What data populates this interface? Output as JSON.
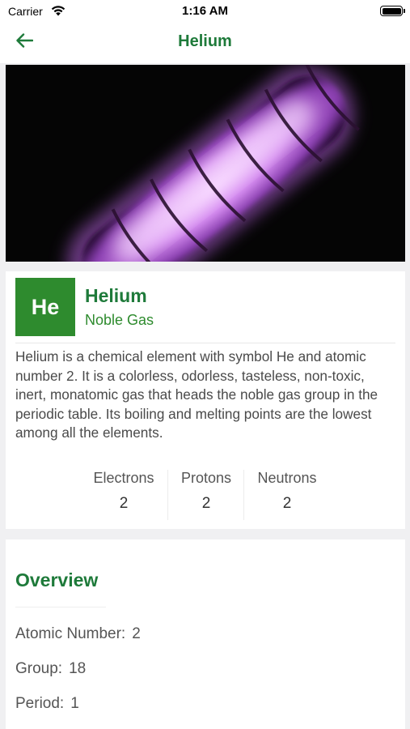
{
  "status_bar": {
    "carrier": "Carrier",
    "time": "1:16 AM"
  },
  "nav": {
    "title": "Helium",
    "back_icon": "arrow-left-icon"
  },
  "colors": {
    "accent": "#1e7a3a",
    "symbol_bg": "#2e8b2e",
    "page_bg": "#f0f0f2"
  },
  "element": {
    "symbol": "He",
    "name": "Helium",
    "category": "Noble Gas",
    "description": "Helium is a chemical element with symbol He and atomic number 2. It is a colorless, odorless, tasteless, non-toxic, inert, monatomic gas that heads the noble gas group in the periodic table. Its boiling and melting points are the lowest among all the elements.",
    "stats": [
      {
        "label": "Electrons",
        "value": "2"
      },
      {
        "label": "Protons",
        "value": "2"
      },
      {
        "label": "Neutrons",
        "value": "2"
      }
    ]
  },
  "overview": {
    "title": "Overview",
    "rows": [
      {
        "label": "Atomic Number:",
        "value": "2"
      },
      {
        "label": "Group:",
        "value": "18"
      },
      {
        "label": "Period:",
        "value": "1"
      }
    ]
  }
}
